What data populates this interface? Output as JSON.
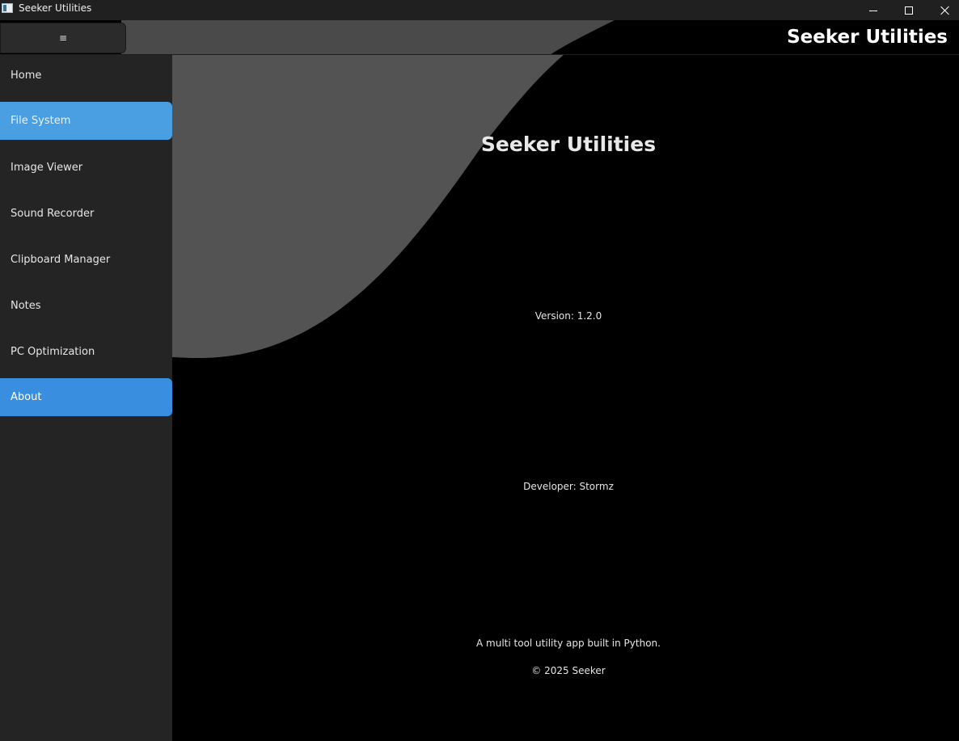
{
  "window": {
    "title": "Seeker Utilities",
    "controls": [
      "minimize-icon",
      "maximize-icon",
      "close-icon"
    ]
  },
  "header": {
    "menu_label": "≡",
    "title": "Seeker Utilities"
  },
  "sidebar": {
    "items": [
      {
        "label": "Home",
        "state": "normal"
      },
      {
        "label": "File System",
        "state": "hover"
      },
      {
        "label": "Image Viewer",
        "state": "normal"
      },
      {
        "label": "Sound Recorder",
        "state": "normal"
      },
      {
        "label": "Clipboard Manager",
        "state": "normal"
      },
      {
        "label": "Notes",
        "state": "normal"
      },
      {
        "label": "PC Optimization",
        "state": "normal"
      },
      {
        "label": "About",
        "state": "selected"
      }
    ]
  },
  "about": {
    "title": "Seeker Utilities",
    "version": "Version: 1.2.0",
    "developer": "Developer: Stormz",
    "description": "A multi tool utility app built in Python.",
    "copyright": "© 2025 Seeker"
  },
  "colors": {
    "accent": "#3a8ee0",
    "hover": "#4a9ee2",
    "sidebar_bg": "#242424",
    "content_bg": "#000000",
    "wave": "#535353"
  }
}
